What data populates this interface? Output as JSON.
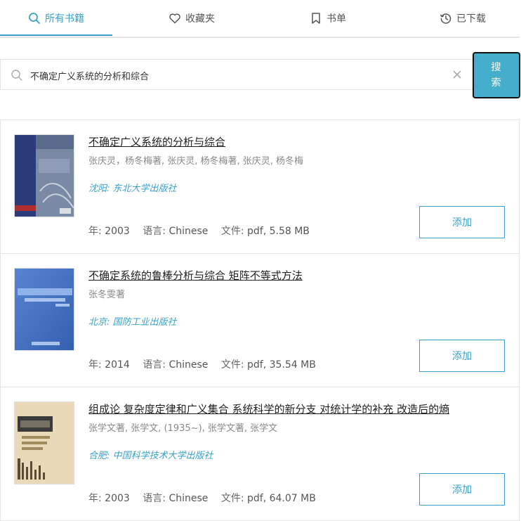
{
  "tabs": [
    {
      "label": "所有书籍",
      "icon": "search-icon",
      "active": true
    },
    {
      "label": "收藏夹",
      "icon": "heart-icon",
      "active": false
    },
    {
      "label": "书单",
      "icon": "bookmark-icon",
      "active": false
    },
    {
      "label": "已下载",
      "icon": "history-icon",
      "active": false
    }
  ],
  "search": {
    "value": "不确定广义系统的分析和综合",
    "button_label_line1": "搜",
    "button_label_line2": "索"
  },
  "labels": {
    "year": "年:",
    "language": "语言:",
    "file": "文件:",
    "add": "添加"
  },
  "books": [
    {
      "title": "不确定广义系统的分析与综合",
      "authors": "张庆灵，杨冬梅著, 张庆灵, 杨冬梅著, 张庆灵, 杨冬梅",
      "publisher": "沈阳: 东北大学出版社",
      "year": "2003",
      "language": "Chinese",
      "file": "pdf, 5.58 MB"
    },
    {
      "title": "不确定系统的鲁棒分析与综合 矩阵不等式方法",
      "authors": "张冬雯著",
      "publisher": "北京: 国防工业出版社",
      "year": "2014",
      "language": "Chinese",
      "file": "pdf, 35.54 MB"
    },
    {
      "title": "组成论 复杂度定律和广义集合 系统科学的新分支 对统计学的补充 改造后的熵",
      "authors": "张学文著, 张学文, (1935~), 张学文著, 张学文",
      "publisher": "合肥: 中国科学技术大学出版社",
      "year": "2003",
      "language": "Chinese",
      "file": "pdf, 64.07 MB"
    }
  ],
  "colors": {
    "accent": "#3aa0c8",
    "search_button": "#45aecd",
    "border": "#e4e4e4"
  }
}
